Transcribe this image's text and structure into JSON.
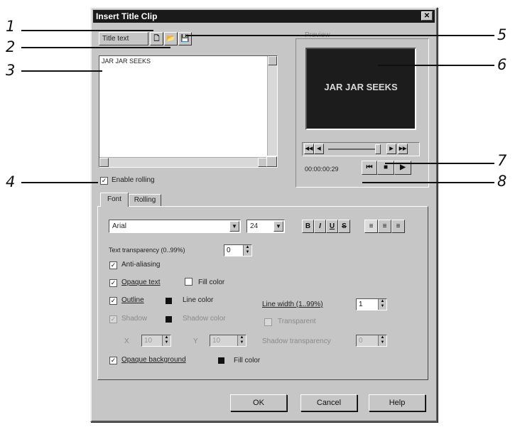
{
  "dialog": {
    "title": "Insert Title Clip",
    "close_glyph": "✕"
  },
  "title_text": {
    "label": "Title text",
    "content": "JAR JAR SEEKS",
    "new_glyph": "🗋",
    "open_glyph": "📂",
    "save_glyph": "💾"
  },
  "enable_rolling": {
    "label": "Enable rolling",
    "checked": true
  },
  "preview": {
    "label": "Preview",
    "text": "JAR JAR SEEKS",
    "timecode": "00:00:00:29",
    "background": "#1c1c1c",
    "text_color": "#d8d8d8"
  },
  "tabs": [
    {
      "label": "Font"
    },
    {
      "label": "Rolling"
    }
  ],
  "font": {
    "family": "Arial",
    "size": "24",
    "bold_glyph": "B",
    "italic_glyph": "I",
    "underline_glyph": "U",
    "strike_glyph": "S",
    "align_left_glyph": "≡",
    "align_center_glyph": "≡",
    "align_right_glyph": "≡",
    "transparency_label": "Text transparency (0..99%)",
    "transparency_value": "0",
    "anti_alias_label": "Anti-aliasing",
    "opaque_text_label": "Opaque text",
    "fill_color_label": "Fill color",
    "outline_label": "Outline",
    "line_color_label": "Line color",
    "line_width_label": "Line width (1..99%)",
    "line_width_value": "1",
    "shadow_label": "Shadow",
    "shadow_color_label": "Shadow color",
    "shadow_x_label": "X",
    "shadow_x_value": "10",
    "shadow_y_label": "Y",
    "shadow_y_value": "10",
    "transparent_label": "Transparent",
    "shadow_transparency_label": "Shadow transparency",
    "shadow_transparency_value": "0",
    "opaque_bg_label": "Opaque background",
    "bg_fill_color_label": "Fill color"
  },
  "buttons": {
    "ok": "OK",
    "cancel": "Cancel",
    "help": "Help"
  },
  "callouts": [
    "1",
    "2",
    "3",
    "4",
    "5",
    "6",
    "7",
    "8"
  ]
}
